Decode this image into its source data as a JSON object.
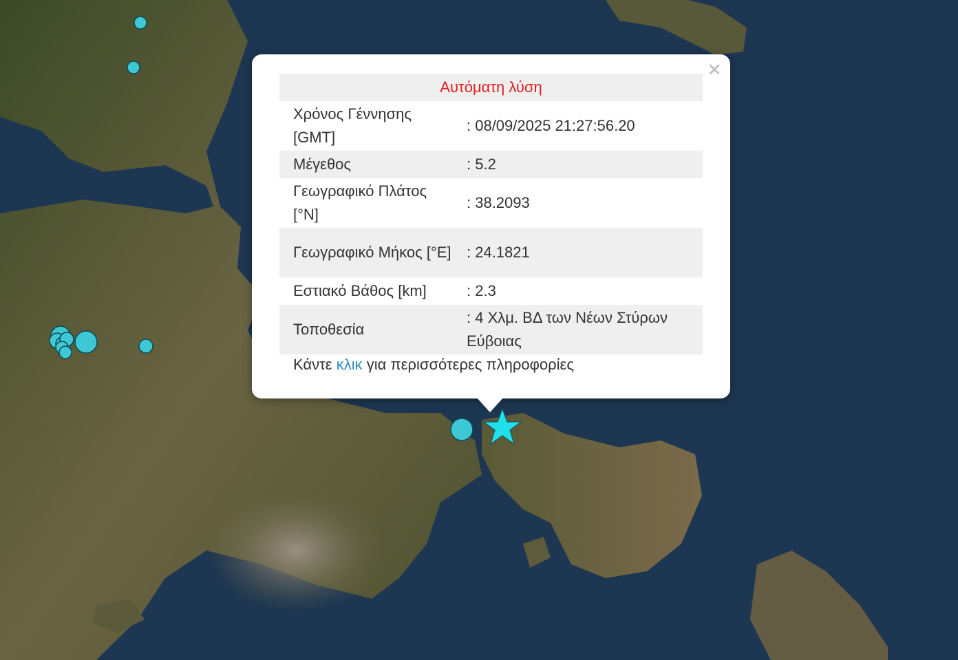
{
  "popup": {
    "title": "Αυτόματη λύση",
    "close_icon": "close-icon",
    "rows": [
      {
        "label": "Χρόνος Γέννησης [GMT]",
        "value": ": 08/09/2025 21:27:56.20"
      },
      {
        "label": "Μέγεθος",
        "value": ": 5.2"
      },
      {
        "label": "Γεωγραφικό Πλάτος [°N]",
        "value": ": 38.2093"
      },
      {
        "label": "Γεωγραφικό Μήκος [°E]",
        "value": ": 24.1821"
      },
      {
        "label": "Εστιακό Βάθος [km]",
        "value": ": 2.3"
      },
      {
        "label": "Τοποθεσία",
        "value": ": 4 Χλμ. ΒΔ των Νέων Στύρων Εύβοιας"
      }
    ],
    "footer_prefix": "Κάντε",
    "footer_link": "κλικ",
    "footer_suffix": "για περισσότερες πληροφορίες"
  },
  "markers": {
    "epicenter_icon": "star-icon",
    "event_icon": "circle-icon",
    "event_count": 12
  },
  "colors": {
    "sea": "#1c3550",
    "land": "#5a5638",
    "marker": "#3fd0e0",
    "title": "#e02020",
    "link": "#2b8cbf"
  }
}
